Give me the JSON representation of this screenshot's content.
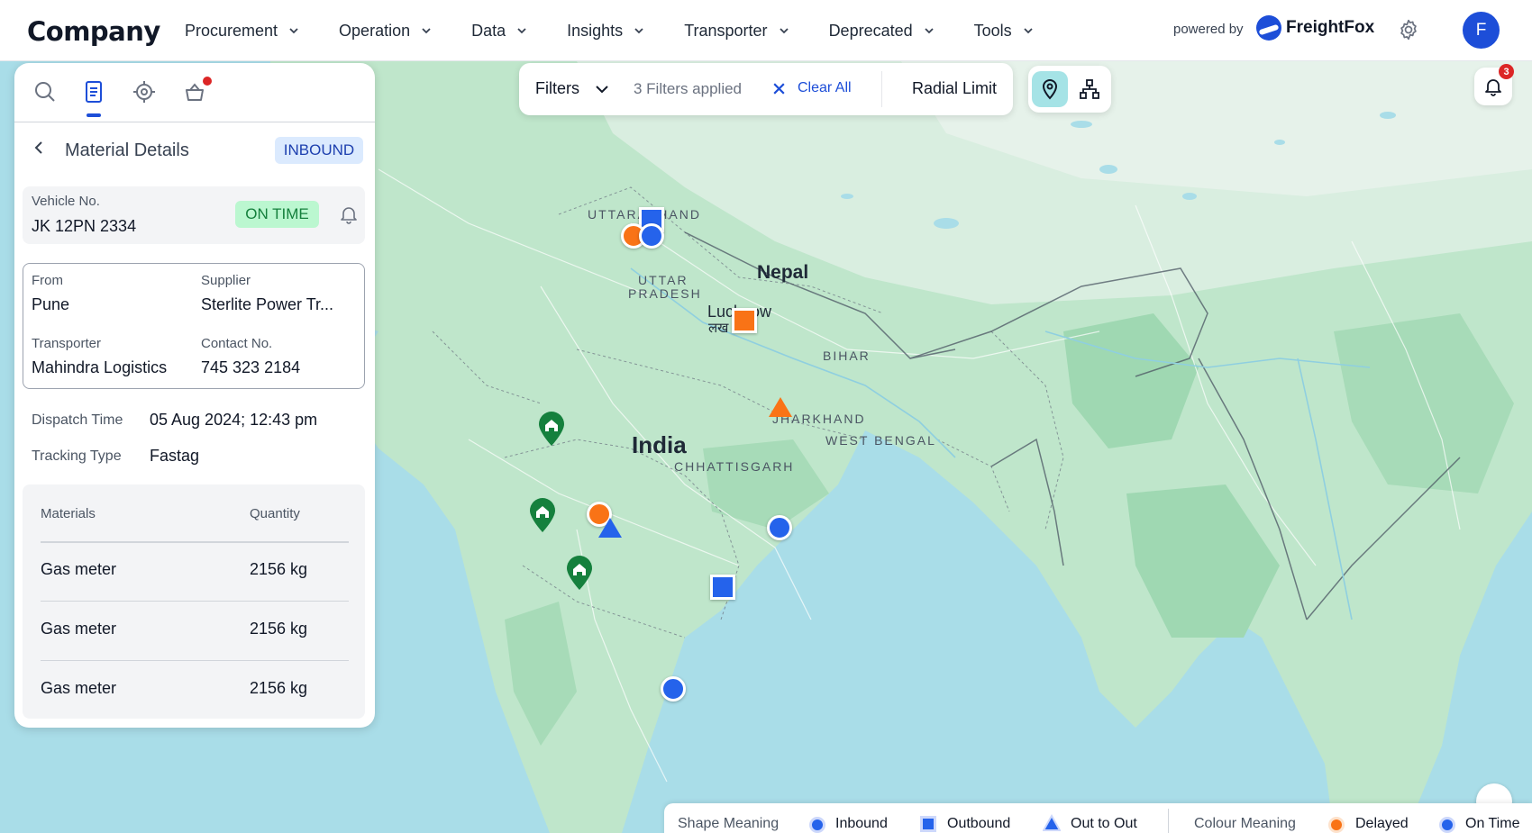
{
  "header": {
    "logo": "Company",
    "nav": [
      {
        "label": "Procurement"
      },
      {
        "label": "Operation"
      },
      {
        "label": "Data"
      },
      {
        "label": "Insights"
      },
      {
        "label": "Transporter"
      },
      {
        "label": "Deprecated"
      },
      {
        "label": "Tools"
      }
    ],
    "powered_by": "powered by",
    "brand": "FreightFox",
    "avatar_initial": "F",
    "icons": [
      "chevron-down-icon",
      "settings-gear-icon",
      "freightfox-logo-icon"
    ]
  },
  "filters": {
    "label": "Filters",
    "applied": "3 Filters applied",
    "clear": "Clear All",
    "radial": "Radial Limit"
  },
  "notifications": {
    "count": "3"
  },
  "map": {
    "labels": {
      "uttarakhand": "UTTARAKHAND",
      "uttar_pradesh_1": "UTTAR",
      "uttar_pradesh_2": "PRADESH",
      "nepal": "Nepal",
      "lucknow": "Lucknow",
      "lucknow_hi": "लख",
      "bihar": "BIHAR",
      "jharkhand": "JHARKHAND",
      "west_bengal": "WEST BENGAL",
      "india": "India",
      "chhattisgarh": "CHHATTISGARH"
    },
    "colors": {
      "water": "#a9dde8",
      "land": "#bfe6cb",
      "inbound_ontime": "#2563eb",
      "delayed": "#f97316",
      "home": "#15803d"
    }
  },
  "panel": {
    "tabs": [
      "search-icon",
      "document-icon",
      "target-icon",
      "basket-icon"
    ],
    "title": "Material Details",
    "direction_badge": "INBOUND",
    "vehicle": {
      "label": "Vehicle No.",
      "value": "JK 12PN 2334",
      "status": "ON TIME"
    },
    "details": {
      "from_label": "From",
      "from_value": "Pune",
      "supplier_label": "Supplier",
      "supplier_value": "Sterlite Power Tr...",
      "transporter_label": "Transporter",
      "transporter_value": "Mahindra Logistics",
      "contact_label": "Contact No.",
      "contact_value": "745 323 2184"
    },
    "dispatch_label": "Dispatch Time",
    "dispatch_value": "05 Aug 2024; 12:43 pm",
    "tracking_label": "Tracking Type",
    "tracking_value": "Fastag",
    "materials": {
      "col_material": "Materials",
      "col_quantity": "Quantity",
      "rows": [
        {
          "name": "Gas meter",
          "qty": "2156 kg"
        },
        {
          "name": "Gas meter",
          "qty": "2156 kg"
        },
        {
          "name": "Gas meter",
          "qty": "2156 kg"
        }
      ]
    }
  },
  "legend": {
    "shape_title": "Shape Meaning",
    "inbound": "Inbound",
    "outbound": "Outbound",
    "out_to_out": "Out to Out",
    "colour_title": "Colour Meaning",
    "delayed": "Delayed",
    "on_time": "On Time"
  }
}
